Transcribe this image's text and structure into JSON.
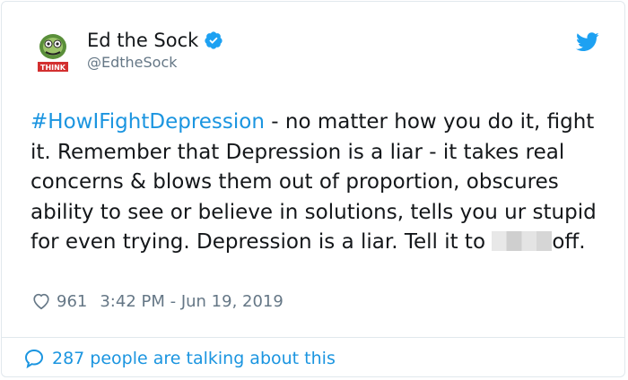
{
  "author": {
    "display_name": "Ed the Sock",
    "handle": "@EdtheSock",
    "avatar_badge": "THINK",
    "verified": true
  },
  "tweet": {
    "hashtag": "#HowIFightDepression",
    "text_before_redaction": " - no matter how you do it, fight it. Remember that Depression is a liar - it takes real concerns & blows them out of proportion, obscures ability to see or believe in solutions, tells you ur stupid for even trying. Depression is a liar. Tell it to ",
    "text_after_redaction": "off."
  },
  "meta": {
    "likes": "961",
    "timestamp": "3:42 PM - Jun 19, 2019"
  },
  "footer": {
    "talking_label": "287 people are talking about this"
  },
  "colors": {
    "link": "#1b95e0",
    "muted": "#657786",
    "text": "#14171a"
  }
}
